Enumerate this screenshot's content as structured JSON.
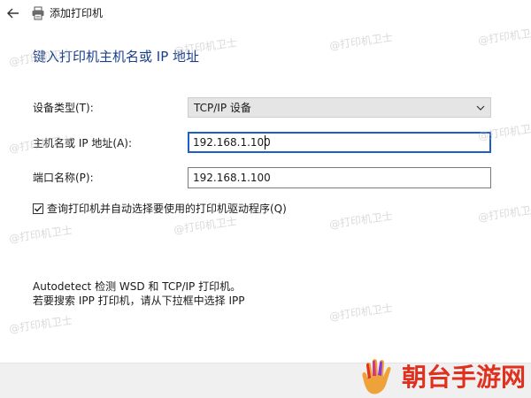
{
  "window": {
    "title": "添加打印机"
  },
  "page": {
    "heading": "键入打印机主机名或 IP 地址"
  },
  "form": {
    "device_type": {
      "label": "设备类型(T):",
      "value": "TCP/IP 设备"
    },
    "host": {
      "label": "主机名或 IP 地址(A):",
      "value": "192.168.1.100"
    },
    "port": {
      "label": "端口名称(P):",
      "value": "192.168.1.100"
    },
    "query_driver": {
      "label": "查询打印机并自动选择要使用的打印机驱动程序(Q)",
      "checked": true
    }
  },
  "info": {
    "line1": "Autodetect 检测 WSD 和 TCP/IP 打印机。",
    "line2": "若要搜索 IPP 打印机，请从下拉框中选择 IPP"
  },
  "watermark": {
    "text": "@打印机卫士"
  },
  "brand": {
    "text": "朝台手游网"
  },
  "colors": {
    "heading": "#1a3f8a",
    "focus_border": "#1e5ec8",
    "brand": "#e0301e"
  }
}
